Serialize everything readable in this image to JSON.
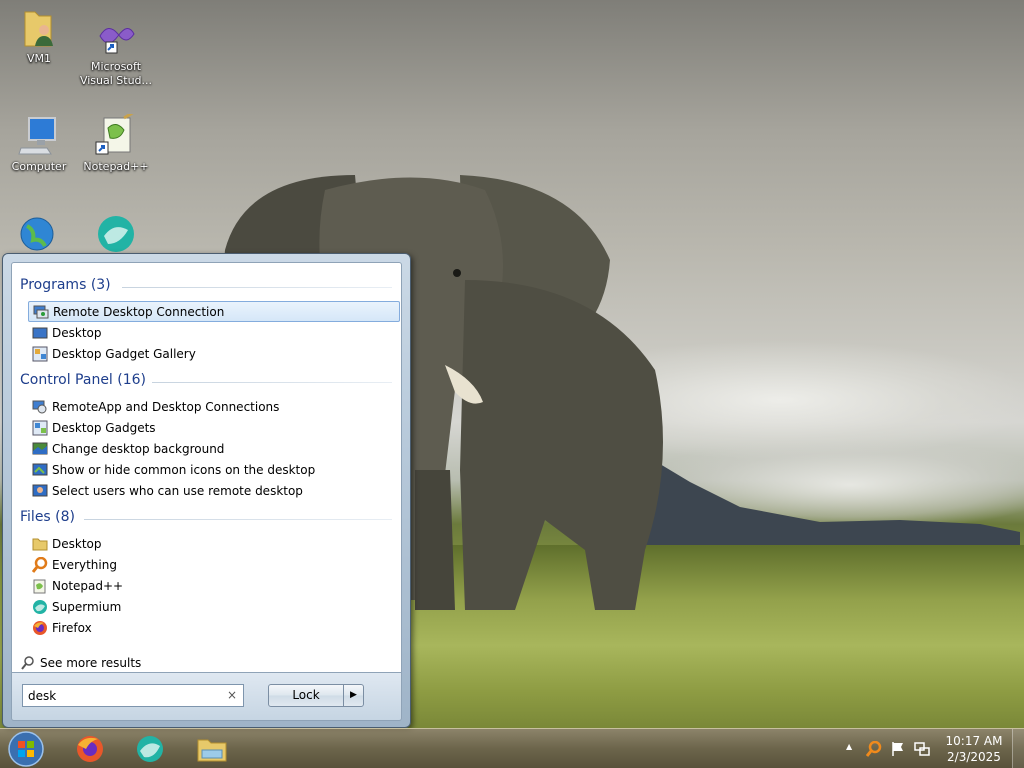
{
  "desktop": {
    "icons": [
      {
        "label": "VM1"
      },
      {
        "label": "Microsoft Visual Stud..."
      },
      {
        "label": "Computer"
      },
      {
        "label": "Notepad++"
      }
    ]
  },
  "start_menu": {
    "groups": {
      "programs": {
        "title": "Programs (3)",
        "items": [
          "Remote Desktop Connection",
          "Desktop",
          "Desktop Gadget Gallery"
        ]
      },
      "control_panel": {
        "title": "Control Panel (16)",
        "items": [
          "RemoteApp and Desktop Connections",
          "Desktop Gadgets",
          "Change desktop background",
          "Show or hide common icons on the desktop",
          "Select users who can use remote desktop"
        ]
      },
      "files": {
        "title": "Files (8)",
        "items": [
          "Desktop",
          "Everything",
          "Notepad++",
          "Supermium",
          "Firefox"
        ]
      }
    },
    "see_more": "See more results",
    "search": {
      "value": "desk",
      "clear_glyph": "×"
    },
    "lock_label": "Lock",
    "lock_arrow": "▶"
  },
  "taskbar": {
    "clock": {
      "time": "10:17 AM",
      "date": "2/3/2025"
    },
    "tray_arrow": "▲"
  },
  "colors": {
    "group_title": "#1e3e8c",
    "selection_border": "#84acdd"
  }
}
